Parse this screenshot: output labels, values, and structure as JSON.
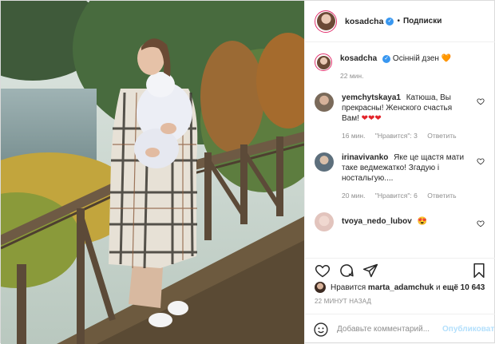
{
  "post": {
    "author": "kosadcha",
    "follow_label": "Подписки",
    "caption": {
      "username": "kosadcha",
      "text": "Осінній дзен",
      "emoji": "🧡",
      "time": "22 мин."
    },
    "comments": [
      {
        "username": "yemchytskaya1",
        "text": "Катюша, Вы прекрасны! Женского счастья Вам!",
        "emoji": "❤❤❤",
        "time": "16 мин.",
        "likes": "\"Нравится\": 3",
        "reply": "Ответить",
        "avatar_color": "#7a6a5a"
      },
      {
        "username": "irinavivanko",
        "text": "Яке це щастя мати таке ведмежатко! Згадую і ностальгую....",
        "emoji": "",
        "time": "20 мин.",
        "likes": "\"Нравится\": 6",
        "reply": "Ответить",
        "avatar_color": "#5d6f7c"
      },
      {
        "username": "tvoya_nedo_lubov",
        "text": "",
        "emoji": "😍",
        "time": "",
        "likes": "",
        "reply": "",
        "avatar_color": "#e2c4bd"
      }
    ],
    "likes_line": {
      "prefix": "Нравится",
      "user": "marta_adamchuk",
      "middle": "и",
      "count": "ещё 10 643"
    },
    "timestamp": "22 минут назад",
    "comment_input": {
      "placeholder": "Добавьте комментарий...",
      "publish_label": "Опубликовать"
    },
    "colors": {
      "accent": "#3897f0",
      "text": "#262626",
      "muted": "#8e8e8e",
      "like_red": "#e3242b"
    }
  }
}
